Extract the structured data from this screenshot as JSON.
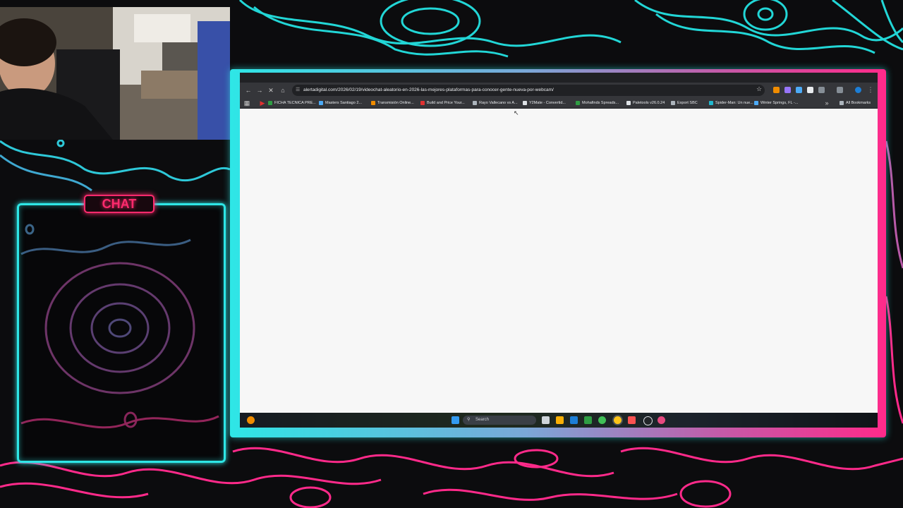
{
  "overlay": {
    "chat_title": "CHAT"
  },
  "browser": {
    "url": "alertadigital.com/2026/02/19/videochat-aleatorio-en-2026-las-mejores-plataformas-para-conocer-gente-nueva-por-webcam/",
    "bookmarks": [
      {
        "label": "FICHA TECNICA PRE...",
        "color": "#2f9e44"
      },
      {
        "label": "Masters Santiago 2...",
        "color": "#4dabf7"
      },
      {
        "label": "Transmisión Online...",
        "color": "#f08c00"
      },
      {
        "label": "Build and Price Your...",
        "color": "#e03131"
      },
      {
        "label": "Rayo Vallecano vs A...",
        "color": "#adb5bd"
      },
      {
        "label": "Y2Mate - Convertid...",
        "color": "#dee2e6"
      },
      {
        "label": "Mohafinds Spreads...",
        "color": "#2f9e44"
      },
      {
        "label": "Paletools v26.0.24",
        "color": "#dee2e6"
      },
      {
        "label": "Export SBC",
        "color": "#adb5bd"
      },
      {
        "label": "Spider-Man: Un nue...",
        "color": "#22b8cf"
      },
      {
        "label": "Winter Springs, FL -...",
        "color": "#4dabf7"
      }
    ],
    "all_bookmarks_label": "All Bookmarks"
  },
  "taskbar": {
    "search_placeholder": "Search"
  }
}
